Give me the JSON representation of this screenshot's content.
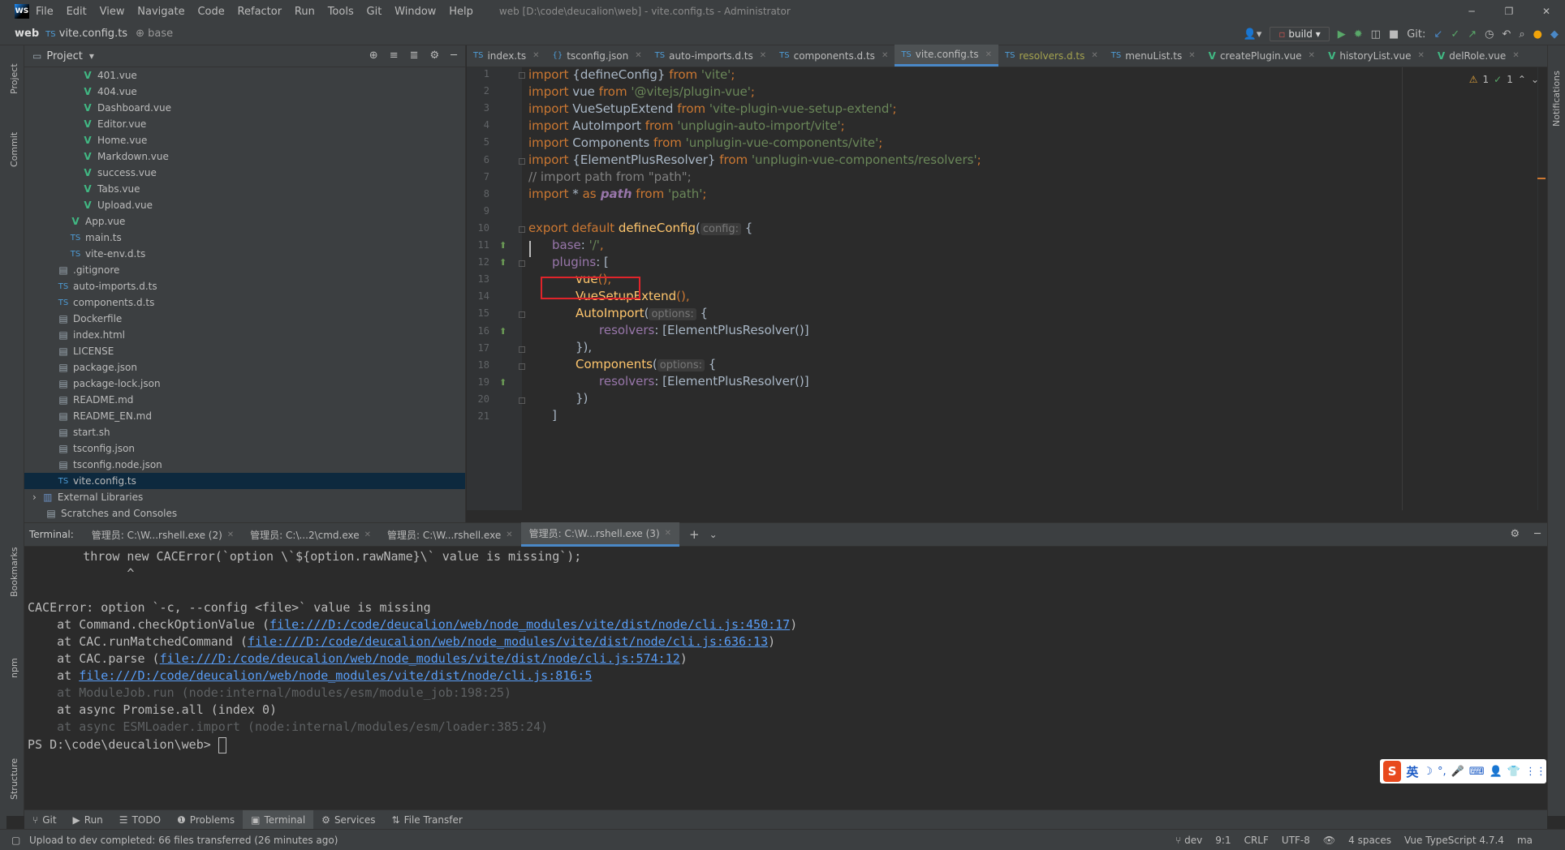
{
  "window": {
    "logo": "WS",
    "menu": [
      "File",
      "Edit",
      "View",
      "Navigate",
      "Code",
      "Refactor",
      "Run",
      "Tools",
      "Git",
      "Window",
      "Help"
    ],
    "title": "web [D:\\code\\deucalion\\web] - vite.config.ts - Administrator",
    "controls": {
      "minimize": "─",
      "maximize": "❐",
      "close": "✕"
    }
  },
  "navbar": {
    "project": "web",
    "file": "vite.config.ts",
    "symbol": "base",
    "run_config": "build",
    "git_label": "Git:"
  },
  "left_tabs": {
    "project": "Project",
    "commit": "Commit",
    "bookmarks": "Bookmarks",
    "npm": "npm",
    "structure": "Structure"
  },
  "right_tabs": {
    "notifications": "Notifications"
  },
  "project_panel": {
    "title": "Project",
    "items": [
      {
        "label": "401.vue",
        "type": "vue",
        "indent": 4
      },
      {
        "label": "404.vue",
        "type": "vue",
        "indent": 4
      },
      {
        "label": "Dashboard.vue",
        "type": "vue",
        "indent": 4
      },
      {
        "label": "Editor.vue",
        "type": "vue",
        "indent": 4
      },
      {
        "label": "Home.vue",
        "type": "vue",
        "indent": 4
      },
      {
        "label": "Markdown.vue",
        "type": "vue",
        "indent": 4
      },
      {
        "label": "success.vue",
        "type": "vue",
        "indent": 4
      },
      {
        "label": "Tabs.vue",
        "type": "vue",
        "indent": 4
      },
      {
        "label": "Upload.vue",
        "type": "vue",
        "indent": 4
      },
      {
        "label": "App.vue",
        "type": "vue",
        "indent": 3
      },
      {
        "label": "main.ts",
        "type": "ts",
        "indent": 3
      },
      {
        "label": "vite-env.d.ts",
        "type": "ts",
        "indent": 3
      },
      {
        "label": ".gitignore",
        "type": "file",
        "indent": 2
      },
      {
        "label": "auto-imports.d.ts",
        "type": "ts",
        "indent": 2
      },
      {
        "label": "components.d.ts",
        "type": "ts",
        "indent": 2
      },
      {
        "label": "Dockerfile",
        "type": "file",
        "indent": 2
      },
      {
        "label": "index.html",
        "type": "file",
        "indent": 2
      },
      {
        "label": "LICENSE",
        "type": "file",
        "indent": 2
      },
      {
        "label": "package.json",
        "type": "file",
        "indent": 2
      },
      {
        "label": "package-lock.json",
        "type": "file",
        "indent": 2
      },
      {
        "label": "README.md",
        "type": "file",
        "indent": 2
      },
      {
        "label": "README_EN.md",
        "type": "file",
        "indent": 2
      },
      {
        "label": "start.sh",
        "type": "file",
        "indent": 2
      },
      {
        "label": "tsconfig.json",
        "type": "file",
        "indent": 2
      },
      {
        "label": "tsconfig.node.json",
        "type": "file",
        "indent": 2
      },
      {
        "label": "vite.config.ts",
        "type": "ts",
        "indent": 2,
        "selected": true
      },
      {
        "label": "External Libraries",
        "type": "lib",
        "indent": 0,
        "arrow": true
      },
      {
        "label": "Scratches and Consoles",
        "type": "file",
        "indent": 1
      }
    ]
  },
  "editor_tabs": [
    {
      "label": "index.ts",
      "icon": "ts"
    },
    {
      "label": "tsconfig.json",
      "icon": "json"
    },
    {
      "label": "auto-imports.d.ts",
      "icon": "ts"
    },
    {
      "label": "components.d.ts",
      "icon": "ts"
    },
    {
      "label": "vite.config.ts",
      "icon": "ts",
      "active": true
    },
    {
      "label": "resolvers.d.ts",
      "icon": "ts",
      "modified": true
    },
    {
      "label": "menuList.ts",
      "icon": "ts"
    },
    {
      "label": "createPlugin.vue",
      "icon": "vue"
    },
    {
      "label": "historyList.vue",
      "icon": "vue"
    },
    {
      "label": "delRole.vue",
      "icon": "vue"
    }
  ],
  "inspections": {
    "warnings": "1",
    "ok": "1"
  },
  "code": {
    "line_numbers": [
      "1",
      "2",
      "3",
      "4",
      "5",
      "6",
      "7",
      "8",
      "9",
      "10",
      "11",
      "12",
      "13",
      "14",
      "15",
      "16",
      "17",
      "18",
      "19",
      "20",
      "21"
    ],
    "l1_kw": "import",
    "l1_a": " {",
    "l1_b": "defineConfig",
    "l1_c": "} ",
    "l1_from": "from",
    "l1_str": " 'vite'",
    "l1_end": ";",
    "l2_kw": "import",
    "l2_a": " vue ",
    "l2_from": "from",
    "l2_str": " '@vitejs/plugin-vue'",
    "l2_end": ";",
    "l3_kw": "import",
    "l3_a": " VueSetupExtend ",
    "l3_from": "from",
    "l3_str": " 'vite-plugin-vue-setup-extend'",
    "l3_end": ";",
    "l4_kw": "import",
    "l4_a": " AutoImport ",
    "l4_from": "from",
    "l4_str": " 'unplugin-auto-import/vite'",
    "l4_end": ";",
    "l5_kw": "import",
    "l5_a": " Components ",
    "l5_from": "from",
    "l5_str": " 'unplugin-vue-components/vite'",
    "l5_end": ";",
    "l6_kw": "import",
    "l6_a": " {",
    "l6_b": "ElementPlusResolver",
    "l6_c": "} ",
    "l6_from": "from",
    "l6_str": " 'unplugin-vue-components/resolvers'",
    "l6_end": ";",
    "l7": "// import path from \"path\";",
    "l8_kw": "import",
    "l8_a": " * ",
    "l8_as": "as",
    "l8_path": " path",
    "l8_from": " from",
    "l8_str": " 'path'",
    "l8_end": ";",
    "l10_kw": "export default",
    "l10_fn": " defineConfig",
    "l10_a": "(",
    "l10_hint": "config:",
    "l10_b": " {",
    "l11_pr": "base",
    "l11_a": ": ",
    "l11_str": "'/'",
    "l11_b": ",",
    "l12_pr": "plugins",
    "l12_a": ": [",
    "l13_fn": "vue",
    "l13_a": "(),",
    "l14_fn": "VueSetupExtend",
    "l14_a": "(),",
    "l15_fn": "AutoImport",
    "l15_a": "(",
    "l15_hint": "options:",
    "l15_b": " {",
    "l16_pr": "resolvers",
    "l16_a": ": [",
    "l16_fn": "ElementPlusResolver",
    "l16_b": "()]",
    "l17": "}),",
    "l18_fn": "Components",
    "l18_a": "(",
    "l18_hint": "options:",
    "l18_b": " {",
    "l19_pr": "resolvers",
    "l19_a": ": [",
    "l19_fn": "ElementPlusResolver",
    "l19_b": "()]",
    "l20": "})",
    "l21": "]"
  },
  "terminal": {
    "label": "Terminal:",
    "tabs": [
      {
        "label": "管理员: C:\\W...rshell.exe (2)"
      },
      {
        "label": "管理员: C:\\...2\\cmd.exe"
      },
      {
        "label": "管理员: C:\\W...rshell.exe"
      },
      {
        "label": "管理员: C:\\W...rshell.exe (3)",
        "active": true
      }
    ],
    "lines": {
      "throw": "        throw new CACError(`option \\`${option.rawName}\\` value is missing`);",
      "caret": "              ^",
      "error": "CACError: option `-c, --config <file>` value is missing",
      "at1_pre": "    at Command.checkOptionValue (",
      "at1_link": "file:///D:/code/deucalion/web/node_modules/vite/dist/node/cli.js:450:17",
      "at1_post": ")",
      "at2_pre": "    at CAC.runMatchedCommand (",
      "at2_link": "file:///D:/code/deucalion/web/node_modules/vite/dist/node/cli.js:636:13",
      "at2_post": ")",
      "at3_pre": "    at CAC.parse (",
      "at3_link": "file:///D:/code/deucalion/web/node_modules/vite/dist/node/cli.js:574:12",
      "at3_post": ")",
      "at4_pre": "    at ",
      "at4_link": "file:///D:/code/deucalion/web/node_modules/vite/dist/node/cli.js:816:5",
      "at5": "    at ModuleJob.run (node:internal/modules/esm/module_job:198:25)",
      "at6": "    at async Promise.all (index 0)",
      "at7": "    at async ESMLoader.import (node:internal/modules/esm/loader:385:24)",
      "prompt": "PS D:\\code\\deucalion\\web> "
    }
  },
  "ime": {
    "logo": "S",
    "lang": "英",
    "icons": [
      "☽",
      "°,",
      "🎤",
      "⌨",
      "👤",
      "👕",
      "⋮⋮"
    ]
  },
  "tool_tabs": [
    "Git",
    "Run",
    "TODO",
    "Problems",
    "Terminal",
    "Services",
    "File Transfer"
  ],
  "status": {
    "message": "Upload to dev completed: 66 files transferred (26 minutes ago)",
    "branch": "dev",
    "position": "9:1",
    "line_sep": "CRLF",
    "encoding": "UTF-8",
    "indent": "4 spaces",
    "language": "Vue TypeScript 4.7.4",
    "extra": "ma"
  }
}
